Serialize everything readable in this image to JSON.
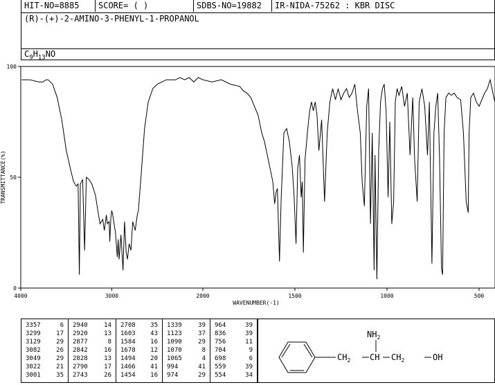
{
  "header": {
    "hit_no": "HIT-NO=8885",
    "score": "SCORE=  (   )",
    "sdbs_no": "SDBS-NO=19882",
    "ir_info": "IR-NIDA-75262 : KBR DISC"
  },
  "compound_name": "(R)-(+)-2-AMINO-3-PHENYL-1-PROPANOL",
  "formula": {
    "c": "C",
    "c_n": "9",
    "h": "H",
    "h_n": "13",
    "rest": "NO"
  },
  "chart_data": {
    "type": "line",
    "xlabel": "WAVENUMBER(-1)",
    "ylabel": "TRANSMITTANCE(%)",
    "xlim": [
      4000,
      400
    ],
    "ylim": [
      0,
      100
    ],
    "x_ticks": [
      4000,
      3000,
      2000,
      1500,
      1000,
      500
    ],
    "y_ticks": [
      0,
      50,
      100
    ],
    "grid": false,
    "series": [
      {
        "x": [
          3990,
          3900,
          3800,
          3760,
          3720,
          3700,
          3650,
          3600,
          3550,
          3500,
          3450,
          3420,
          3390,
          3370,
          3357,
          3345,
          3320,
          3299,
          3280,
          3250,
          3220,
          3180,
          3150,
          3129,
          3100,
          3082,
          3060,
          3049,
          3030,
          3022,
          3010,
          3001,
          2990,
          2960,
          2940,
          2930,
          2920,
          2900,
          2877,
          2860,
          2842,
          2828,
          2810,
          2790,
          2770,
          2743,
          2720,
          2708,
          2680,
          2640,
          2600,
          2550,
          2500,
          2450,
          2400,
          2350,
          2300,
          2250,
          2200,
          2150,
          2100,
          2050,
          2000,
          1950,
          1900,
          1850,
          1800,
          1780,
          1760,
          1740,
          1720,
          1700,
          1680,
          1665,
          1650,
          1635,
          1620,
          1610,
          1603,
          1595,
          1584,
          1575,
          1560,
          1545,
          1530,
          1515,
          1505,
          1494,
          1485,
          1475,
          1466,
          1460,
          1454,
          1445,
          1430,
          1420,
          1410,
          1400,
          1390,
          1380,
          1370,
          1355,
          1339,
          1325,
          1310,
          1295,
          1280,
          1265,
          1250,
          1235,
          1220,
          1205,
          1190,
          1175,
          1160,
          1145,
          1135,
          1123,
          1110,
          1100,
          1090,
          1080,
          1070,
          1065,
          1055,
          1045,
          1035,
          1025,
          1015,
          1005,
          994,
          985,
          974,
          964,
          955,
          945,
          935,
          920,
          905,
          890,
          875,
          860,
          850,
          836,
          825,
          810,
          795,
          780,
          770,
          756,
          745,
          735,
          725,
          715,
          704,
          698,
          690,
          680,
          665,
          650,
          635,
          620,
          600,
          585,
          570,
          559,
          554,
          545,
          530,
          515,
          500,
          485,
          470,
          455,
          440,
          420,
          405
        ],
        "y": [
          94,
          94,
          93,
          93,
          94,
          94,
          92,
          86,
          76,
          62,
          53,
          48,
          46,
          47,
          6,
          47,
          49,
          17,
          50,
          49,
          47,
          42,
          34,
          29,
          31,
          26,
          33,
          29,
          30,
          21,
          32,
          35,
          33,
          25,
          14,
          22,
          13,
          24,
          8,
          30,
          16,
          13,
          20,
          17,
          30,
          26,
          33,
          35,
          50,
          72,
          84,
          90,
          92,
          93,
          94,
          94,
          94,
          95,
          94,
          95,
          93,
          95,
          94,
          93,
          94,
          92,
          91,
          89,
          88,
          86,
          82,
          78,
          70,
          66,
          60,
          54,
          48,
          38,
          43,
          45,
          12,
          40,
          70,
          72,
          66,
          55,
          42,
          20,
          54,
          60,
          41,
          48,
          16,
          58,
          72,
          80,
          84,
          80,
          84,
          78,
          62,
          76,
          39,
          70,
          84,
          90,
          85,
          90,
          85,
          88,
          90,
          86,
          88,
          92,
          80,
          70,
          48,
          37,
          82,
          90,
          29,
          70,
          8,
          60,
          4,
          62,
          84,
          90,
          92,
          80,
          41,
          75,
          29,
          39,
          84,
          90,
          87,
          91,
          82,
          88,
          60,
          86,
          58,
          39,
          84,
          90,
          82,
          60,
          84,
          11,
          70,
          82,
          88,
          60,
          9,
          6,
          70,
          86,
          88,
          87,
          88,
          86,
          85,
          70,
          39,
          34,
          70,
          86,
          88,
          84,
          82,
          85,
          88,
          90,
          94,
          86,
          84
        ]
      }
    ]
  },
  "peak_table": {
    "columns": [
      [
        [
          "3357",
          "6"
        ],
        [
          "3299",
          "17"
        ],
        [
          "3129",
          "29"
        ],
        [
          "3082",
          "26"
        ],
        [
          "3049",
          "29"
        ],
        [
          "3022",
          "21"
        ],
        [
          "3001",
          "35"
        ]
      ],
      [
        [
          "2940",
          "14"
        ],
        [
          "2920",
          "13"
        ],
        [
          "2877",
          "8"
        ],
        [
          "2842",
          "16"
        ],
        [
          "2828",
          "13"
        ],
        [
          "2790",
          "17"
        ],
        [
          "2743",
          "26"
        ]
      ],
      [
        [
          "2708",
          "35"
        ],
        [
          "1603",
          "43"
        ],
        [
          "1584",
          "16"
        ],
        [
          "1678",
          "12"
        ],
        [
          "1494",
          "20"
        ],
        [
          "1466",
          "41"
        ],
        [
          "1454",
          "16"
        ]
      ],
      [
        [
          "1339",
          "39"
        ],
        [
          "1123",
          "37"
        ],
        [
          "1090",
          "29"
        ],
        [
          "1070",
          "8"
        ],
        [
          "1065",
          "4"
        ],
        [
          "994",
          "41"
        ],
        [
          "974",
          "29"
        ]
      ],
      [
        [
          "964",
          "39"
        ],
        [
          "836",
          "39"
        ],
        [
          "756",
          "11"
        ],
        [
          "704",
          "9"
        ],
        [
          "698",
          "6"
        ],
        [
          "559",
          "39"
        ],
        [
          "554",
          "34"
        ]
      ]
    ]
  },
  "structure": {
    "nh2": "NH",
    "nh2_sub": "2",
    "ch2a": "CH",
    "ch2a_sub": "2",
    "ch": "CH",
    "ch2b": "CH",
    "ch2b_sub": "2",
    "oh": "OH"
  }
}
